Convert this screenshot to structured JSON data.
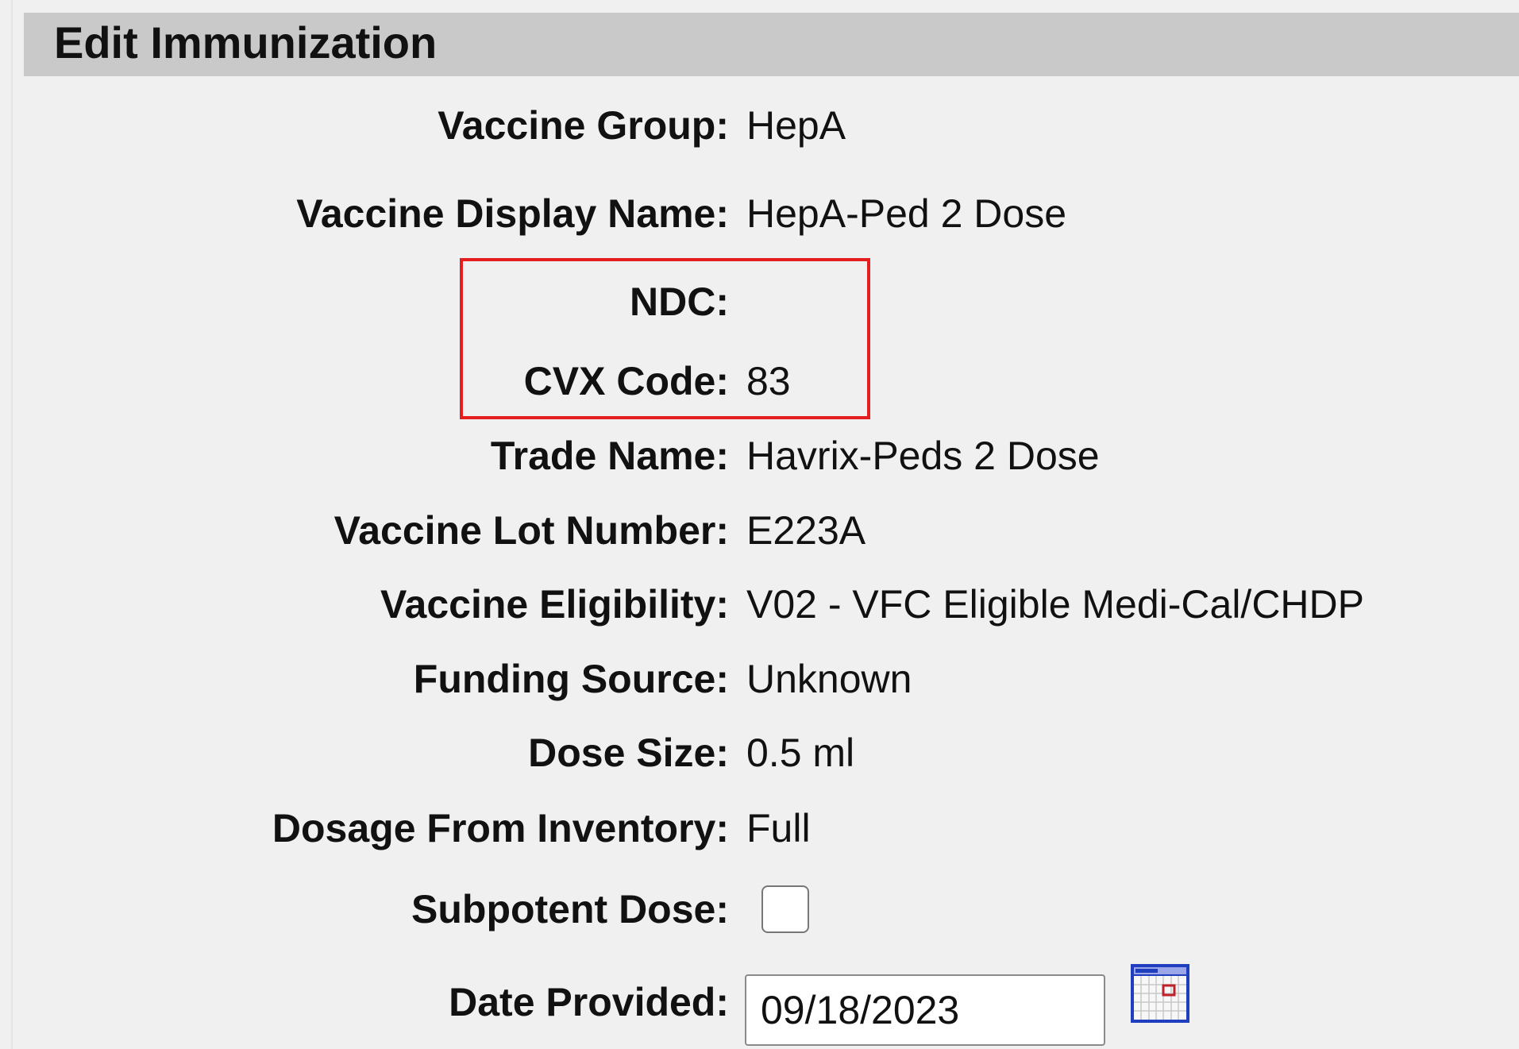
{
  "header": {
    "title": "Edit Immunization"
  },
  "fields": {
    "vaccine_group": {
      "label": "Vaccine Group:",
      "value": "HepA"
    },
    "vaccine_display_name": {
      "label": "Vaccine Display Name:",
      "value": "HepA-Ped 2 Dose"
    },
    "ndc": {
      "label": "NDC:",
      "value": ""
    },
    "cvx_code": {
      "label": "CVX Code:",
      "value": "83"
    },
    "trade_name": {
      "label": "Trade Name:",
      "value": "Havrix-Peds 2 Dose"
    },
    "vaccine_lot_number": {
      "label": "Vaccine Lot Number:",
      "value": "E223A"
    },
    "vaccine_eligibility": {
      "label": "Vaccine Eligibility:",
      "value": "V02 - VFC Eligible Medi-Cal/CHDP"
    },
    "funding_source": {
      "label": "Funding Source:",
      "value": "Unknown"
    },
    "dose_size": {
      "label": "Dose Size:",
      "value": "0.5 ml"
    },
    "dosage_from_inventory": {
      "label": "Dosage From Inventory:",
      "value": "Full"
    },
    "subpotent_dose": {
      "label": "Subpotent Dose:",
      "checked": false
    },
    "date_provided": {
      "label": "Date Provided:",
      "value": "09/18/2023"
    }
  },
  "icons": {
    "calendar": "calendar-icon",
    "checkbox": "checkbox-icon"
  },
  "colors": {
    "page_background": "#f0f0f0",
    "header_background": "#c9c9c9",
    "highlight_border": "#e41e1e",
    "calendar_blue": "#1f3fbf",
    "calendar_red": "#c0202a"
  }
}
